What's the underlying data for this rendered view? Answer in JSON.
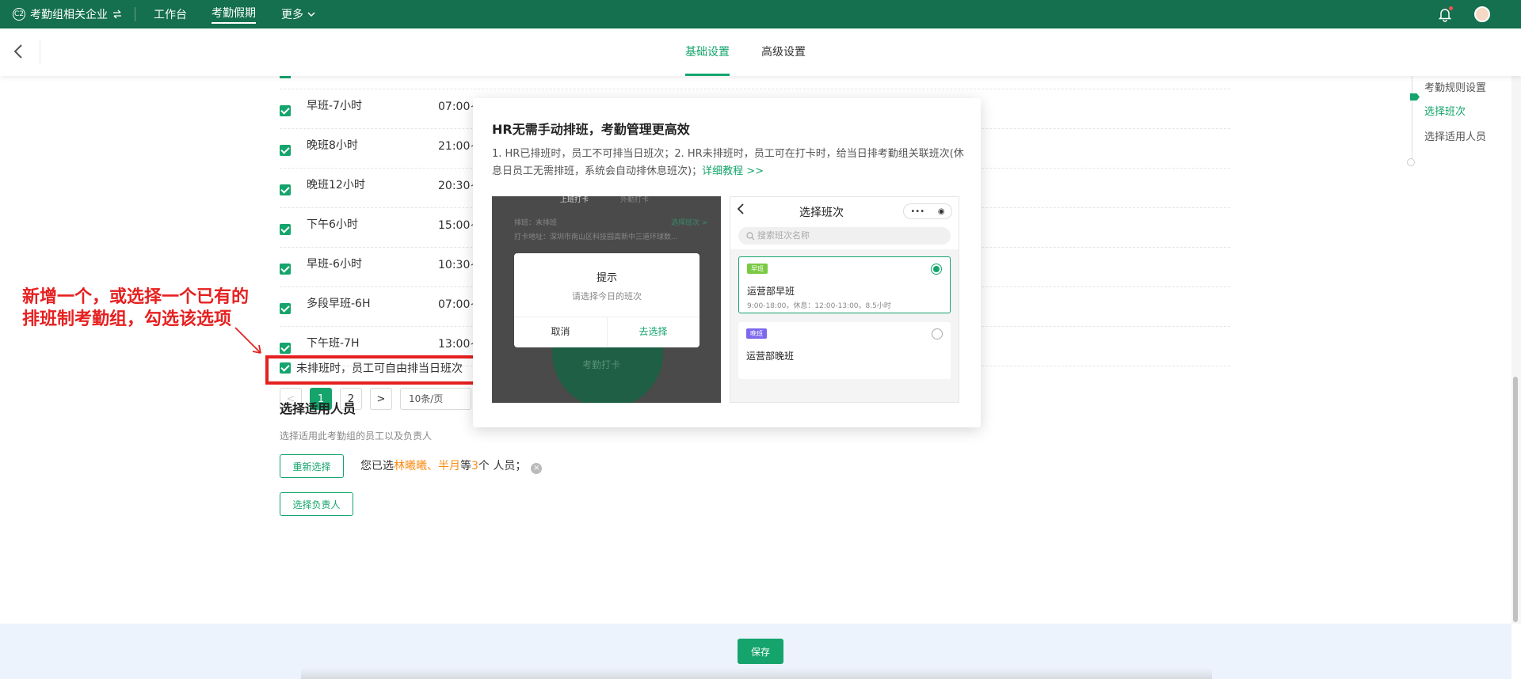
{
  "topbar": {
    "brand": "考勤组相关企业",
    "brand_logo": "C2",
    "nav": [
      "工作台",
      "考勤假期",
      "更多"
    ],
    "active_nav": "考勤假期"
  },
  "subbar": {
    "tabs": [
      "基础设置",
      "高级设置"
    ],
    "active_tab": "基础设置"
  },
  "shifts": [
    {
      "name": "早班-7小时",
      "time": "07:00~"
    },
    {
      "name": "晚班8小时",
      "time": "21:00~"
    },
    {
      "name": "晚班12小时",
      "time": "20:30~"
    },
    {
      "name": "下午6小时",
      "time": "15:00~"
    },
    {
      "name": "早班-6小时",
      "time": "10:30~"
    },
    {
      "name": "多段早班-6H",
      "time": "07:00~"
    },
    {
      "name": "下午班-7H",
      "time": "13:00~"
    }
  ],
  "pager": {
    "prev": "<",
    "pages": [
      "1",
      "2"
    ],
    "current": "1",
    "next": ">",
    "page_size": "10条/页"
  },
  "option": {
    "label": "未排班时，员工可自由排当日班次",
    "help": "?",
    "checked": true
  },
  "annotation": {
    "line1": "新增一个，或选择一个已有的",
    "line2": "排班制考勤组，勾选该选项",
    "color": "#e62020"
  },
  "people": {
    "title": "选择适用人员",
    "desc": "选择适用此考勤组的员工以及负责人",
    "reselect": "重新选择",
    "selected_prefix": "您已选",
    "selected_names": "林曦曦、半月",
    "selected_mid": "等",
    "selected_count": "3",
    "selected_suffix": "个 人员；",
    "clear": "×",
    "choose_owner": "选择负责人"
  },
  "popup": {
    "title": "HR无需手动排班，考勤管理更高效",
    "desc": "1. HR已排班时，员工不可排当日班次；2. HR未排班时，员工可在打卡时，给当日排考勤组关联班次(休息日员工无需排班，系统会自动排休息班次)；",
    "link": "详细教程 >>",
    "shot1": {
      "tab_a": "上班打卡",
      "tab_b": "外勤打卡",
      "line1": "排班：未排班",
      "line1_link": "选择班次 >",
      "line2": "打卡地址：深圳市南山区科技园高新中三道环球数...",
      "dialog_title": "提示",
      "dialog_desc": "请选择今日的班次",
      "cancel": "取消",
      "confirm": "去选择",
      "button": "考勤打卡"
    },
    "shot2": {
      "title": "选择班次",
      "search_placeholder": "搜索班次名称",
      "cards": [
        {
          "tag": "早班",
          "name": "运营部早班",
          "detail": "9:00-18:00，休息：12:00-13:00，8.5小时",
          "tag_color": "#7ac943",
          "selected": true
        },
        {
          "tag": "晚班",
          "name": "运营部晚班",
          "detail": "",
          "tag_color": "#7b68ee",
          "selected": false
        }
      ]
    }
  },
  "steps": {
    "items": [
      "考勤规则设置",
      "选择班次",
      "选择适用人员"
    ],
    "active": "选择班次"
  },
  "footer": {
    "save": "保存"
  },
  "colors": {
    "primary": "#14a46c",
    "topbar": "#14704f",
    "highlight": "#fa8c16"
  }
}
